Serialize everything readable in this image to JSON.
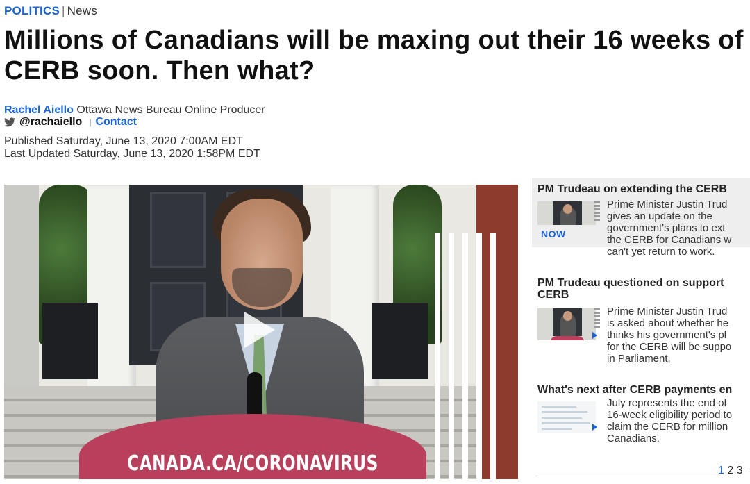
{
  "article": {
    "section": "POLITICS",
    "separator": "|",
    "subsection": "News",
    "headline_line1": "Millions of Canadians will be maxing out their 16 weeks of",
    "headline_line2": "CERB soon. Then what?",
    "author_name": "Rachel Aiello",
    "author_role": "Ottawa News Bureau Online Producer",
    "twitter_handle": "@rachaiello",
    "contact_separator": "|",
    "contact_label": "Contact",
    "published": "Published Saturday, June 13, 2020 7:00AM EDT",
    "updated": "Last Updated Saturday, June 13, 2020 1:58PM EDT"
  },
  "video": {
    "podium_text": "CANADA.CA/CORONAVIRUS",
    "podium_color": "#b8405c"
  },
  "playlist": {
    "items": [
      {
        "title": "PM Trudeau on extending the CERB",
        "badge": "NOW",
        "desc_lines": [
          "Prime Minister Justin Trud",
          "gives an update on the",
          "government's plans to ext",
          "the CERB for Canadians w",
          "can't yet return to work."
        ]
      },
      {
        "title_line1": "PM Trudeau questioned on support",
        "title_line2": "CERB",
        "desc_lines": [
          "Prime Minister Justin Trud",
          "is asked about whether he",
          "thinks his government's pl",
          "for the CERB will be suppo",
          "in Parliament."
        ]
      },
      {
        "title": "What's next after CERB payments en",
        "desc_lines": [
          "July represents the end of",
          "16-week eligibility period to",
          "claim the CERB for million",
          "Canadians."
        ]
      }
    ],
    "pages": [
      "1",
      "2",
      "3"
    ],
    "pager_trailing": "→"
  },
  "colors": {
    "accent": "#1a63d6",
    "active_card_bg": "#eeeeee"
  }
}
